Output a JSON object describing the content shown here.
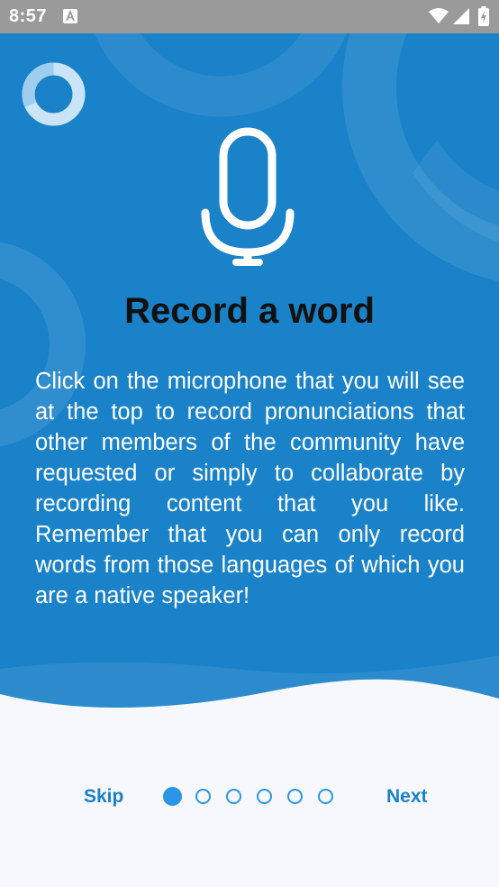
{
  "status_bar": {
    "time": "8:57",
    "icons": [
      "notification-a-icon",
      "wifi-icon",
      "signal-icon",
      "battery-charging-icon"
    ]
  },
  "onboarding": {
    "title": "Record a word",
    "description": "Click on the microphone that you will see at the top to record pronunciations that other members of the community have requested or simply to collaborate by recording content that you like. Remember that you can only record words from those languages of which you are a native speaker!",
    "icon": "microphone-icon",
    "logo": "ring-logo-icon"
  },
  "navigation": {
    "skip_label": "Skip",
    "next_label": "Next",
    "page_count": 6,
    "active_page": 1
  },
  "colors": {
    "hero_background": "#1a82c9",
    "accent": "#2b96e6",
    "bottom_background": "#f7f8fc",
    "title_text": "#111111"
  }
}
